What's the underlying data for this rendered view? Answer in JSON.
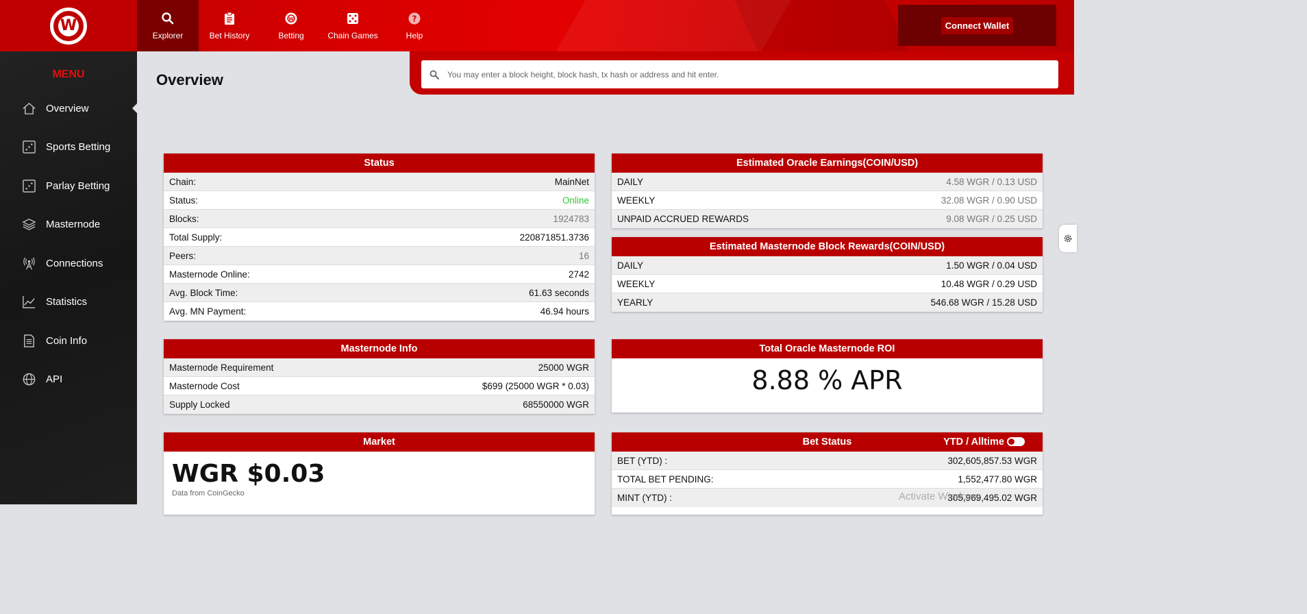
{
  "header": {
    "logo_letter": "W",
    "nav": [
      {
        "label": "Explorer",
        "icon": "search-icon",
        "active": true
      },
      {
        "label": "Bet History",
        "icon": "clipboard-icon"
      },
      {
        "label": "Betting",
        "icon": "wager-icon"
      },
      {
        "label": "Chain Games",
        "icon": "dice-icon"
      },
      {
        "label": "Help",
        "icon": "help-icon"
      }
    ],
    "connect_wallet": "Connect Wallet"
  },
  "sidebar": {
    "title": "MENU",
    "items": [
      {
        "label": "Overview",
        "icon": "home-icon",
        "active": true
      },
      {
        "label": "Sports Betting",
        "icon": "dice-icon"
      },
      {
        "label": "Parlay Betting",
        "icon": "dice-icon"
      },
      {
        "label": "Masternode",
        "icon": "layers-icon"
      },
      {
        "label": "Connections",
        "icon": "antenna-icon"
      },
      {
        "label": "Statistics",
        "icon": "chart-icon"
      },
      {
        "label": "Coin Info",
        "icon": "document-icon"
      },
      {
        "label": "API",
        "icon": "globe-icon"
      }
    ]
  },
  "main": {
    "title": "Overview",
    "search_placeholder": "You may enter a block height, block hash, tx hash or address and hit enter."
  },
  "status": {
    "title": "Status",
    "rows": [
      {
        "label": "Chain:",
        "value": "MainNet"
      },
      {
        "label": "Status:",
        "value": "Online"
      },
      {
        "label": "Blocks:",
        "value": "1924783"
      },
      {
        "label": "Total Supply:",
        "value": "220871851.3736"
      },
      {
        "label": "Peers:",
        "value": "16"
      },
      {
        "label": "Masternode Online:",
        "value": "2742"
      },
      {
        "label": "Avg. Block Time:",
        "value": "61.63 seconds"
      },
      {
        "label": "Avg. MN Payment:",
        "value": "46.94 hours"
      }
    ]
  },
  "oracle_earnings": {
    "title": "Estimated Oracle Earnings(COIN/USD)",
    "rows": [
      {
        "label": "DAILY",
        "value": "4.58 WGR / 0.13 USD"
      },
      {
        "label": "WEEKLY",
        "value": "32.08 WGR / 0.90 USD"
      },
      {
        "label": "UNPAID ACCRUED REWARDS",
        "value": "9.08 WGR / 0.25 USD"
      }
    ]
  },
  "mn_rewards": {
    "title": "Estimated Masternode Block Rewards(COIN/USD)",
    "rows": [
      {
        "label": "DAILY",
        "value": "1.50 WGR / 0.04 USD"
      },
      {
        "label": "WEEKLY",
        "value": "10.48 WGR / 0.29 USD"
      },
      {
        "label": "YEARLY",
        "value": "546.68 WGR / 15.28 USD"
      }
    ]
  },
  "mn_info": {
    "title": "Masternode Info",
    "rows": [
      {
        "label": "Masternode Requirement",
        "value": "25000 WGR"
      },
      {
        "label": "Masternode Cost",
        "value": "$699 (25000 WGR * 0.03)"
      },
      {
        "label": "Supply Locked",
        "value": "68550000 WGR"
      }
    ]
  },
  "roi": {
    "title": "Total Oracle Masternode ROI",
    "value": "8.88 % APR"
  },
  "market": {
    "title": "Market",
    "price": "WGR $0.03",
    "source": "Data from CoinGecko"
  },
  "bet_status": {
    "title": "Bet Status",
    "toggle_label": "YTD / Alltime",
    "rows": [
      {
        "label": "BET (YTD) :",
        "value": "302,605,857.53 WGR"
      },
      {
        "label": "TOTAL BET PENDING:",
        "value": "1,552,477.80 WGR"
      },
      {
        "label": "MINT (YTD) :",
        "value": "305,969,495.02 WGR"
      }
    ]
  },
  "watermark": "Activate Windows",
  "colors": {
    "brand": "#b90000",
    "online": "#32c832"
  }
}
